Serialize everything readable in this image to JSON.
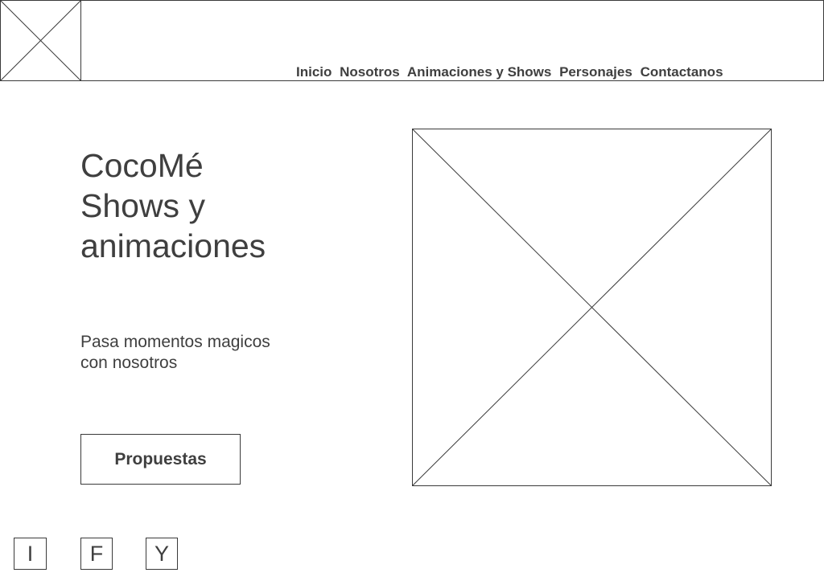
{
  "header": {
    "nav": [
      {
        "label": "Inicio"
      },
      {
        "label": "Nosotros"
      },
      {
        "label": "Animaciones y Shows"
      },
      {
        "label": "Personajes"
      },
      {
        "label": "Contactanos"
      }
    ]
  },
  "hero": {
    "title_lines": [
      "CocoMé",
      "Shows y",
      "animaciones"
    ],
    "subtitle_lines": [
      "Pasa momentos magicos",
      "con nosotros"
    ],
    "cta_label": "Propuestas"
  },
  "social": [
    {
      "label": "I",
      "icon": "instagram-icon"
    },
    {
      "label": "F",
      "icon": "facebook-icon"
    },
    {
      "label": "Y",
      "icon": "youtube-icon"
    }
  ],
  "colors": {
    "text": "#3f3f3f",
    "border": "#3a3a3a",
    "background": "#ffffff"
  }
}
